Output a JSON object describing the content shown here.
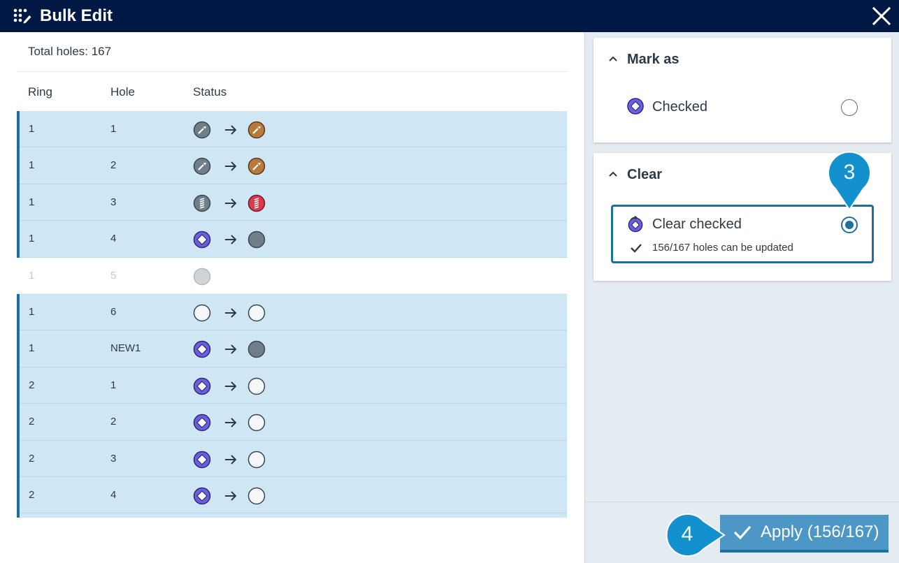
{
  "window": {
    "title": "Bulk Edit"
  },
  "summary": {
    "total_holes": "Total holes: 167"
  },
  "table": {
    "headers": {
      "ring": "Ring",
      "hole": "Hole",
      "status": "Status"
    },
    "rows": [
      {
        "ring": "1",
        "hole": "1",
        "from": "drilled",
        "to": "charged",
        "selected": true
      },
      {
        "ring": "1",
        "hole": "2",
        "from": "drilled",
        "to": "charged",
        "selected": true
      },
      {
        "ring": "1",
        "hole": "3",
        "from": "loaded",
        "to": "loaded-red",
        "selected": true
      },
      {
        "ring": "1",
        "hole": "4",
        "from": "checked",
        "to": "planned-dark",
        "selected": true
      },
      {
        "ring": "1",
        "hole": "5",
        "from": "unavailable",
        "to": "",
        "selected": false
      },
      {
        "ring": "1",
        "hole": "6",
        "from": "empty",
        "to": "empty",
        "selected": true
      },
      {
        "ring": "1",
        "hole": "NEW1",
        "from": "checked",
        "to": "planned-dark",
        "selected": true
      },
      {
        "ring": "2",
        "hole": "1",
        "from": "checked",
        "to": "empty",
        "selected": true
      },
      {
        "ring": "2",
        "hole": "2",
        "from": "checked",
        "to": "empty",
        "selected": true
      },
      {
        "ring": "2",
        "hole": "3",
        "from": "checked",
        "to": "empty",
        "selected": true
      },
      {
        "ring": "2",
        "hole": "4",
        "from": "checked",
        "to": "empty",
        "selected": true
      },
      {
        "ring": "",
        "hole": "",
        "from": "",
        "to": "",
        "selected": true
      }
    ]
  },
  "panel": {
    "mark_as": {
      "title": "Mark as",
      "option": "Checked",
      "selected": false
    },
    "clear": {
      "title": "Clear",
      "option": "Clear checked",
      "selected": true,
      "note": "156/167 holes can be updated"
    }
  },
  "footer": {
    "apply_label": "Apply (156/167)"
  },
  "callouts": {
    "step3": "3",
    "step4": "4"
  },
  "colors": {
    "titlebar": "#001944",
    "accent": "#1e6f9e",
    "row_selected": "#cfe7f4",
    "apply": "#4c97c6",
    "callout": "#1391cf",
    "checked_purple": "#6b5ee0",
    "charged_orange": "#b87a3a",
    "loaded_red": "#d93b4a"
  }
}
